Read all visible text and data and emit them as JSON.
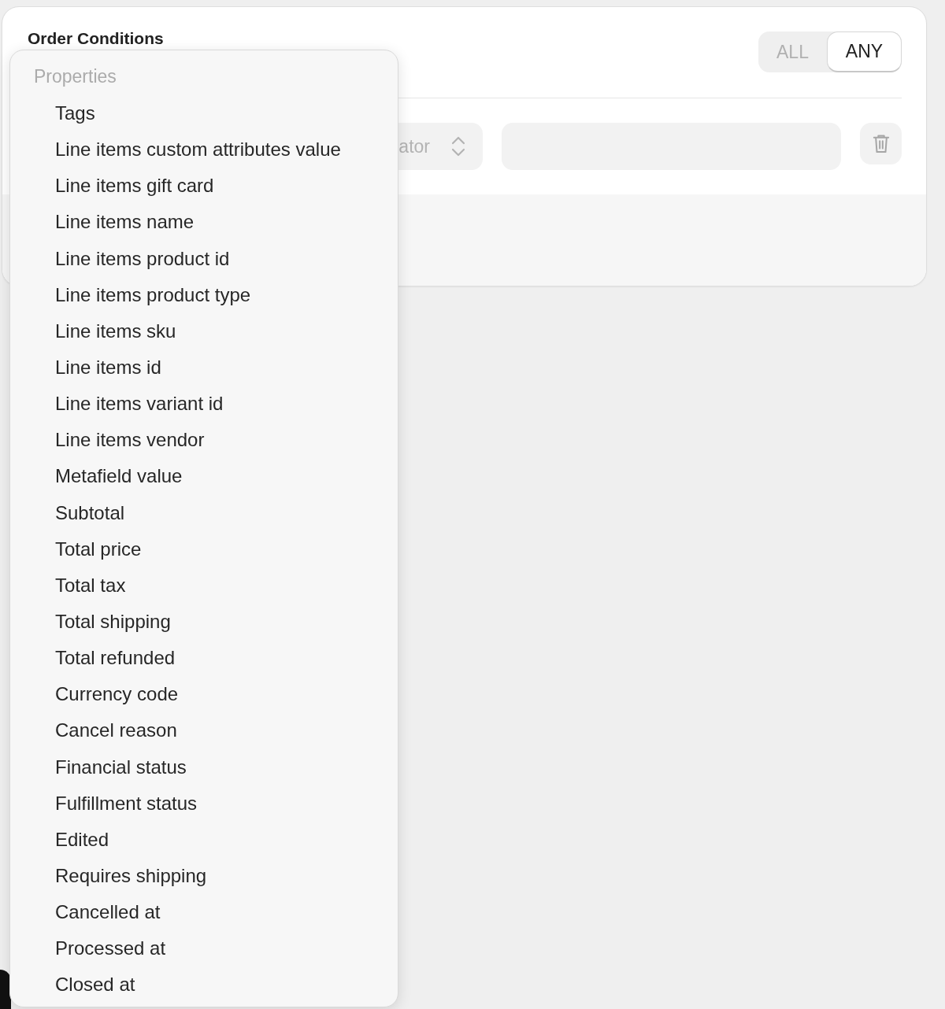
{
  "card": {
    "title": "Order Conditions",
    "match_modes": [
      {
        "label": "ALL",
        "selected": false
      },
      {
        "label": "ANY",
        "selected": true
      }
    ],
    "condition": {
      "operator_select": {
        "placeholder": "ator"
      }
    }
  },
  "dropdown": {
    "heading": "Properties",
    "items": [
      {
        "label": "Tags",
        "selected": false
      },
      {
        "label": "Line items custom attributes value",
        "selected": false
      },
      {
        "label": "Line items gift card",
        "selected": false
      },
      {
        "label": "Line items name",
        "selected": false
      },
      {
        "label": "Line items product id",
        "selected": false
      },
      {
        "label": "Line items product type",
        "selected": false
      },
      {
        "label": "Line items sku",
        "selected": false
      },
      {
        "label": "Line items id",
        "selected": false
      },
      {
        "label": "Line items variant id",
        "selected": false
      },
      {
        "label": "Line items vendor",
        "selected": false
      },
      {
        "label": "Metafield value",
        "selected": false
      },
      {
        "label": "Subtotal",
        "selected": false
      },
      {
        "label": "Total price",
        "selected": false
      },
      {
        "label": "Total tax",
        "selected": false
      },
      {
        "label": "Total shipping",
        "selected": false
      },
      {
        "label": "Total refunded",
        "selected": false
      },
      {
        "label": "Currency code",
        "selected": false
      },
      {
        "label": "Cancel reason",
        "selected": false
      },
      {
        "label": "Financial status",
        "selected": false
      },
      {
        "label": "Fulfillment status",
        "selected": false
      },
      {
        "label": "Edited",
        "selected": false
      },
      {
        "label": "Requires shipping",
        "selected": false
      },
      {
        "label": "Cancelled at",
        "selected": false
      },
      {
        "label": "Processed at",
        "selected": false
      },
      {
        "label": "Closed at",
        "selected": false
      }
    ]
  }
}
